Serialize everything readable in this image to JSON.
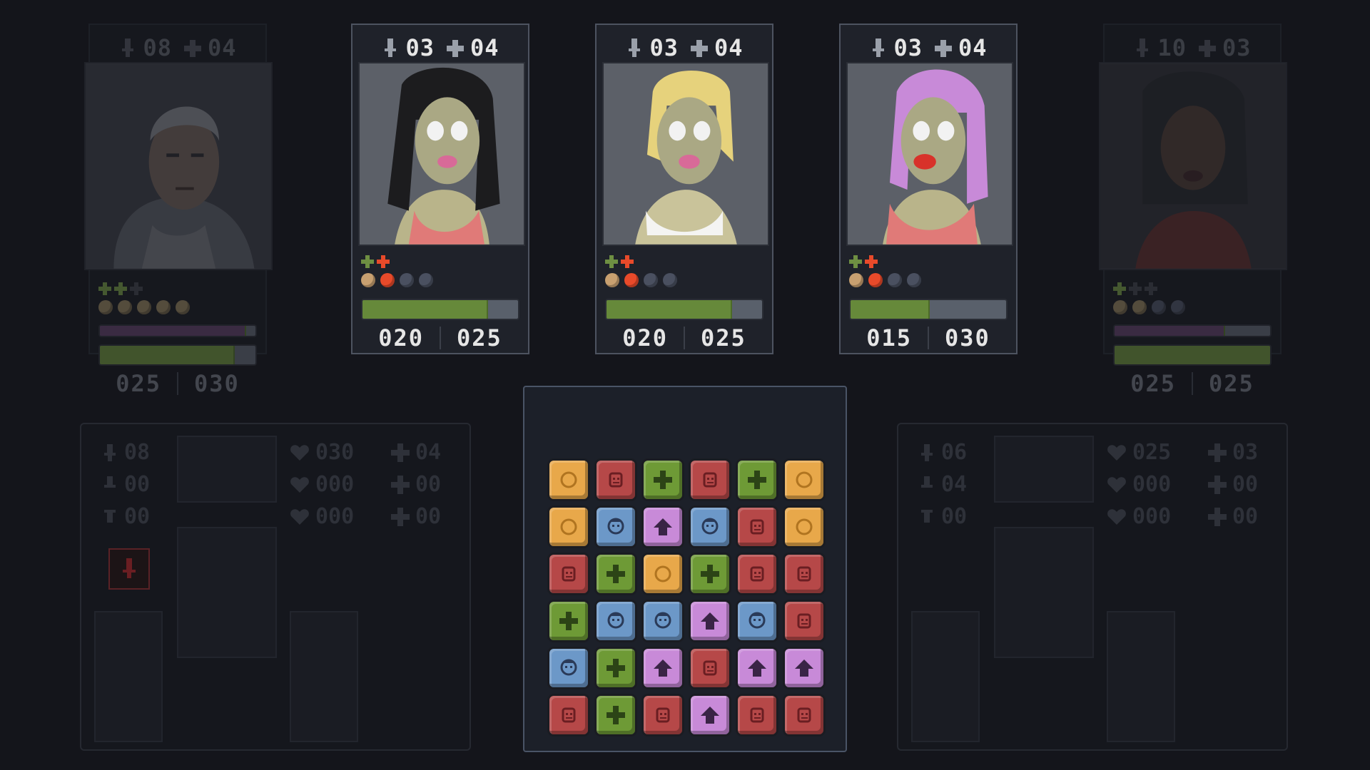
{
  "colors": {
    "background": "#14151b",
    "health_green": "#66893a",
    "tile_coin": "#e8a84a",
    "tile_face": "#b64848",
    "tile_plus": "#6e9a36",
    "tile_person": "#6c98c8",
    "tile_arrow": "#c88ad8"
  },
  "cards": [
    {
      "attack": "08",
      "armor": "04",
      "hp_current": "025",
      "hp_max": "030",
      "health_fraction": 0.86,
      "energy_fraction": 0.93,
      "pips": [
        "#6e8f42",
        "#6e8f42",
        "#3c4048"
      ],
      "dots": [
        "#8a7a58",
        "#8a7a58",
        "#8a7a58",
        "#8a7a58",
        "#8a7a58"
      ]
    },
    {
      "attack": "03",
      "armor": "04",
      "hp_current": "020",
      "hp_max": "025",
      "health_fraction": 0.8,
      "pips": [
        "#6e8f42",
        "#e84a2a"
      ],
      "dots": [
        "#c8a070",
        "#e84a2a",
        "#4a5060",
        "#4a5060"
      ]
    },
    {
      "attack": "03",
      "armor": "04",
      "hp_current": "020",
      "hp_max": "025",
      "health_fraction": 0.8,
      "pips": [
        "#6e8f42",
        "#e84a2a"
      ],
      "dots": [
        "#c8a070",
        "#e84a2a",
        "#4a5060",
        "#4a5060"
      ]
    },
    {
      "attack": "03",
      "armor": "04",
      "hp_current": "015",
      "hp_max": "030",
      "health_fraction": 0.5,
      "pips": [
        "#6e8f42",
        "#e84a2a"
      ],
      "dots": [
        "#c8a070",
        "#e84a2a",
        "#4a5060",
        "#4a5060"
      ]
    },
    {
      "attack": "10",
      "armor": "03",
      "hp_current": "025",
      "hp_max": "025",
      "health_fraction": 1.0,
      "energy_fraction": 0.7,
      "pips": [
        "#6e8f42",
        "#3c4048",
        "#3c4048"
      ],
      "dots": [
        "#8a7a58",
        "#8a7a58",
        "#4a5060",
        "#4a5060"
      ]
    }
  ],
  "left_panel": {
    "attack": "08",
    "attack_bonus": "00",
    "attack_debuff": "00",
    "health": "030",
    "health_bonus": "000",
    "health_debuff": "000",
    "armor": "04",
    "armor_bonus": "00",
    "armor_debuff": "00"
  },
  "right_panel": {
    "attack": "06",
    "attack_bonus": "04",
    "attack_debuff": "00",
    "health": "025",
    "health_bonus": "000",
    "health_debuff": "000",
    "armor": "03",
    "armor_bonus": "00",
    "armor_debuff": "00"
  },
  "board": [
    [
      "coin",
      "face",
      "plus",
      "face",
      "plus",
      "coin"
    ],
    [
      "coin",
      "person",
      "arrow",
      "person",
      "face",
      "coin"
    ],
    [
      "face",
      "plus",
      "coin",
      "plus",
      "face",
      "face"
    ],
    [
      "plus",
      "person",
      "person",
      "arrow",
      "person",
      "face"
    ],
    [
      "person",
      "plus",
      "arrow",
      "face",
      "arrow",
      "arrow"
    ],
    [
      "face",
      "plus",
      "face",
      "arrow",
      "face",
      "face"
    ]
  ]
}
